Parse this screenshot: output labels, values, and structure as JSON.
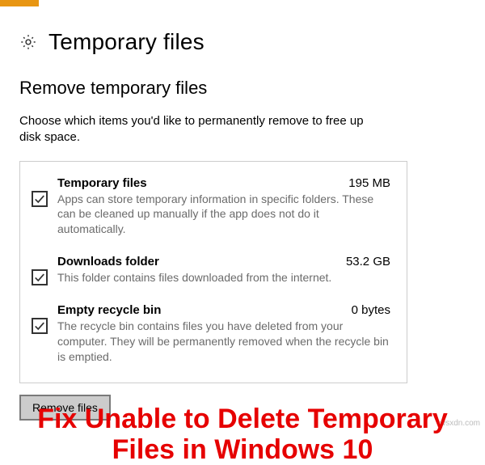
{
  "header": {
    "title": "Temporary files",
    "icon": "gear-icon"
  },
  "section": {
    "title": "Remove temporary files",
    "description": "Choose which items you'd like to permanently remove to free up disk space."
  },
  "items": [
    {
      "title": "Temporary files",
      "size": "195 MB",
      "description": "Apps can store temporary information in specific folders. These can be cleaned up manually if the app does not do it automatically.",
      "checked": true
    },
    {
      "title": "Downloads folder",
      "size": "53.2 GB",
      "description": "This folder contains files downloaded from the internet.",
      "checked": true
    },
    {
      "title": "Empty recycle bin",
      "size": "0 bytes",
      "description": "The recycle bin contains files you have deleted from your computer. They will be permanently removed when the recycle bin is emptied.",
      "checked": true
    }
  ],
  "actions": {
    "remove_label": "Remove files"
  },
  "caption": {
    "line1": "Fix Unable to Delete Temporary",
    "line2": "Files in Windows 10"
  },
  "watermark": "wsxdn.com"
}
